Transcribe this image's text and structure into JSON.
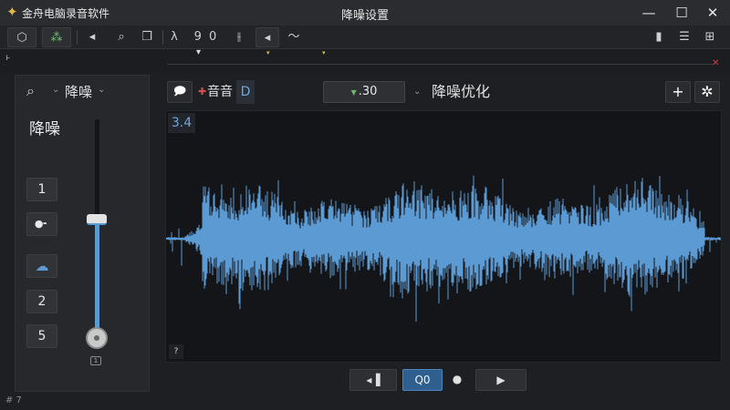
{
  "app": {
    "name": "金舟电脑录音软件",
    "window_title": "降噪设置",
    "controls": {
      "minimize": "—",
      "maximize": "☐",
      "close": "✕"
    }
  },
  "toolbar": {
    "number_display": "9  0"
  },
  "left_panel": {
    "header": "降噪",
    "title": "降噪",
    "buttons": [
      "1",
      "2",
      "5"
    ],
    "slider_level_percent": 55
  },
  "main_header": {
    "audio_label": "音音",
    "audio_suffix": "D",
    "value": ".30",
    "optimize_label": "降噪优化"
  },
  "waveform": {
    "time_badge": "3.4",
    "help": "?",
    "color": "#5b9ad3"
  },
  "transport": {
    "q_button": "Q0"
  },
  "status": {
    "text": "# 7"
  }
}
